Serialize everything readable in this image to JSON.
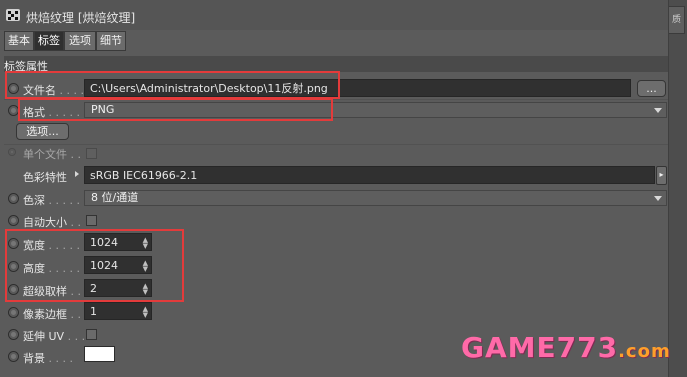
{
  "window": {
    "title": "烘焙纹理 [烘焙纹理]"
  },
  "tabs": [
    {
      "label": "基本"
    },
    {
      "label": "标签"
    },
    {
      "label": "选项"
    },
    {
      "label": "细节"
    }
  ],
  "active_tab": "标签",
  "right_panel": {
    "tab_label": "质"
  },
  "section": {
    "title": "标签属性"
  },
  "fields": {
    "filename": {
      "label": "文件名",
      "dots": ". . . .",
      "value": "C:\\Users\\Administrator\\Desktop\\11反射.png",
      "browse_label": "..."
    },
    "format": {
      "label": "格式",
      "dots": ". . . . . .",
      "value": "PNG"
    },
    "options_button": {
      "label": "选项..."
    },
    "single_file": {
      "label": "单个文件",
      "dots": ". ."
    },
    "color_profile": {
      "label": "色彩特性",
      "value": "sRGB IEC61966-2.1"
    },
    "color_depth": {
      "label": "色深",
      "dots": ". . . . . .",
      "value": "8 位/通道"
    },
    "auto_size": {
      "label": "自动大小",
      "dots": ". ."
    },
    "width": {
      "label": "宽度",
      "dots": ". . . . .",
      "value": "1024"
    },
    "height": {
      "label": "高度",
      "dots": ". . . . .",
      "value": "1024"
    },
    "supersampling": {
      "label": "超级取样",
      "dots": ". . .",
      "value": "2"
    },
    "pixel_border": {
      "label": "像素边框",
      "dots": ". . .",
      "value": "1"
    },
    "stretch_uv": {
      "label": "延伸 UV",
      "dots": ". . ."
    },
    "background": {
      "label": "背景",
      "dots": ". . . .",
      "color": "#ffffff"
    }
  },
  "watermark": {
    "text": "GAME773",
    "domain": ".com"
  },
  "colors": {
    "highlight": "#e33b3b",
    "panel": "#5b5b5b",
    "field": "#303030"
  }
}
